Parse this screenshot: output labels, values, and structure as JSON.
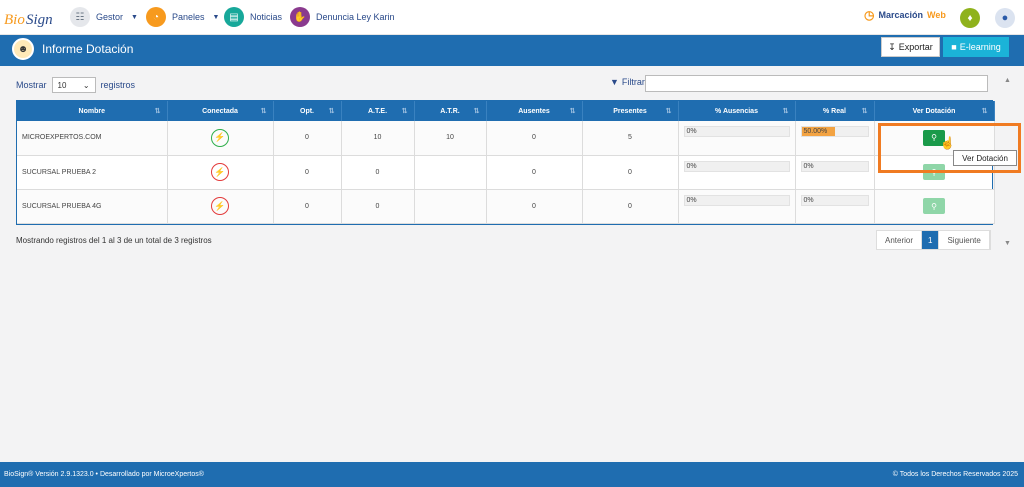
{
  "nav": {
    "logo": "BioSign",
    "items": [
      {
        "label": "Gestor",
        "has_caret": true,
        "color": "#6b7785"
      },
      {
        "label": "Paneles",
        "has_caret": true,
        "color": "#f79a1e"
      },
      {
        "label": "Noticias",
        "has_caret": false,
        "color": "#17a89a"
      },
      {
        "label": "Denuncia Ley Karin",
        "has_caret": false,
        "color": "#8a3a8e"
      }
    ],
    "marcacion": "Marcación",
    "marcacion_web": "Web"
  },
  "header": {
    "title": "Informe Dotación",
    "export_label": "Exportar",
    "elearning_label": "E-learning"
  },
  "controls": {
    "show_label": "Mostrar",
    "page_size": "10",
    "records_label": "registros",
    "filter_label": "Filtrar:"
  },
  "table": {
    "headers": [
      "Nombre",
      "Conectada",
      "Opt.",
      "A.T.E.",
      "A.T.R.",
      "Ausentes",
      "Presentes",
      "% Ausencias",
      "% Real",
      "Ver Dotación"
    ],
    "rows": [
      {
        "nombre": "MICROEXPERTOS.COM",
        "connected": true,
        "opt": "0",
        "ate": "10",
        "atr": "10",
        "ausentes": "0",
        "presentes": "5",
        "pct_ausencias": "0%",
        "pct_real": "50.00%",
        "pct_real_fill": 50
      },
      {
        "nombre": "SUCURSAL PRUEBA 2",
        "connected": false,
        "opt": "0",
        "ate": "0",
        "atr": "",
        "ausentes": "0",
        "presentes": "0",
        "pct_ausencias": "0%",
        "pct_real": "0%",
        "pct_real_fill": 0
      },
      {
        "nombre": "SUCURSAL PRUEBA 4G",
        "connected": false,
        "opt": "0",
        "ate": "0",
        "atr": "",
        "ausentes": "0",
        "presentes": "0",
        "pct_ausencias": "0%",
        "pct_real": "0%",
        "pct_real_fill": 0
      }
    ]
  },
  "tooltip": "Ver Dotación",
  "info": "Mostrando registros del 1 al 3 de un total de 3 registros",
  "pager": {
    "prev": "Anterior",
    "current": "1",
    "next": "Siguiente"
  },
  "footer": {
    "left": "BioSign® Versión 2.9.1323.0 • Desarrollado por MicroeXpertos®",
    "right": "© Todos los Derechos Reservados 2025"
  }
}
